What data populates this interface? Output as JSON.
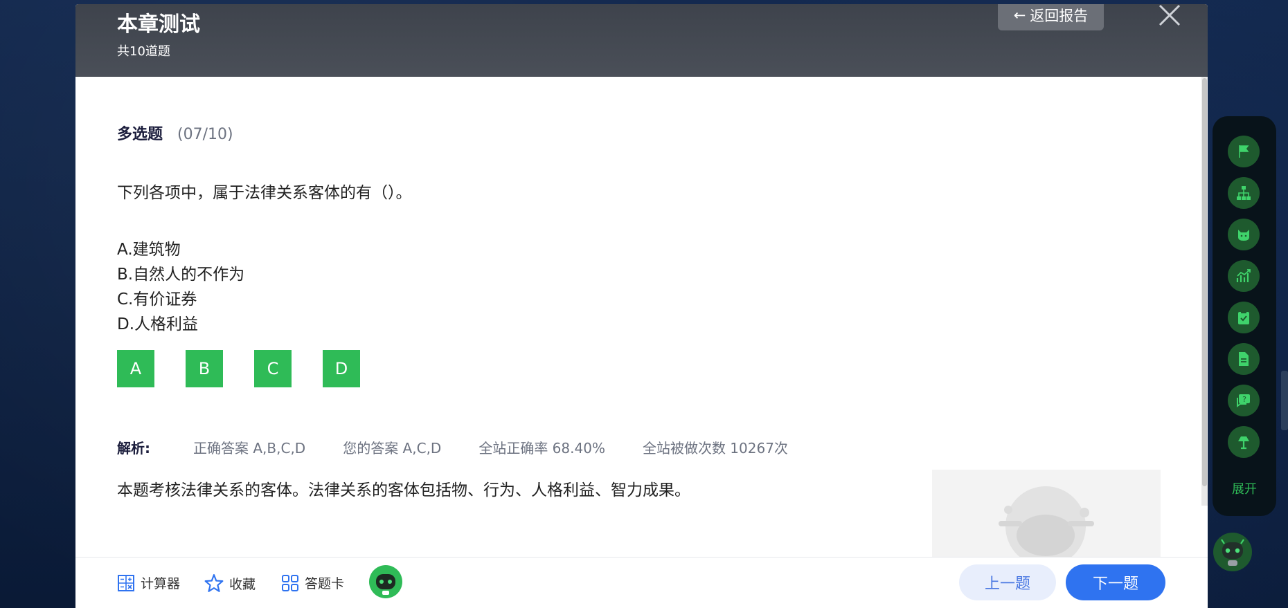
{
  "header": {
    "title": "本章测试",
    "subtitle": "共10道题",
    "back_label": "返回报告"
  },
  "question": {
    "type_label": "多选题",
    "progress": "(07/10)",
    "stem": "下列各项中，属于法律关系客体的有（）。",
    "options": [
      "A.建筑物",
      "B.自然人的不作为",
      "C.有价证券",
      "D.人格利益"
    ],
    "answer_buttons": [
      "A",
      "B",
      "C",
      "D"
    ]
  },
  "analysis": {
    "label": "解析:",
    "correct_answer": "正确答案 A,B,C,D",
    "your_answer": "您的答案 A,C,D",
    "accuracy": "全站正确率 68.40%",
    "attempts": "全站被做次数 10267次",
    "explanation": "本题考核法律关系的客体。法律关系的客体包括物、行为、人格利益、智力成果。"
  },
  "footer": {
    "calculator": "计算器",
    "favorite": "收藏",
    "answer_card": "答题卡",
    "prev": "上一题",
    "next": "下一题"
  },
  "side_rail": {
    "items": [
      "flag-icon",
      "org-chart-icon",
      "mascot-icon",
      "trend-chart-icon",
      "clipboard-check-icon",
      "document-icon",
      "help-chat-icon",
      "lamp-icon"
    ],
    "expand_label": "展开"
  },
  "colors": {
    "accent_green": "#2fbb57",
    "primary_blue": "#2f73f0",
    "header_gray": "#4a4f58"
  }
}
